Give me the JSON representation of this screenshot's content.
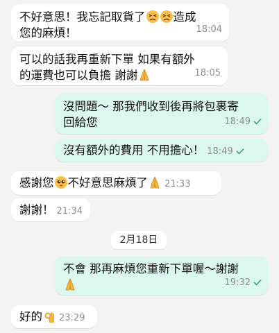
{
  "messages": [
    {
      "line1": "不好意思！我忘記取貨了",
      "line1b": "造成",
      "line2": "您的麻煩！",
      "time": "18:04"
    },
    {
      "line1": "可以的話我再重新下單 如果有額外",
      "line2": "的運費也可以負擔 謝謝",
      "time": "18:05"
    },
    {
      "line1": "沒問題～ 那我們收到後再將包裹寄",
      "line2": "回給您",
      "time": "18:49"
    },
    {
      "line1": "沒有額外的費用 不用擔心！",
      "time": "18:49"
    },
    {
      "line1": "感謝您",
      "line1b": "不好意思麻煩了",
      "time": "21:33"
    },
    {
      "line1": "謝謝！",
      "time": "21:34"
    },
    {
      "line1": "不會 那再麻煩您重新下單喔～謝謝",
      "time": "19:32"
    },
    {
      "line1": "好的",
      "time": "23:29"
    }
  ],
  "date_separator": "2月18日",
  "icons": {
    "persevering": "persevering-face-icon",
    "folded_hands": "folded-hands-icon",
    "pleading": "pleading-face-icon",
    "ok_hand": "ok-hand-icon",
    "read_check": "check-icon"
  },
  "colors": {
    "background": "#f3f3f3",
    "incoming": "#ffffff",
    "outgoing": "#dcf7ee",
    "check": "#3e9c86"
  }
}
